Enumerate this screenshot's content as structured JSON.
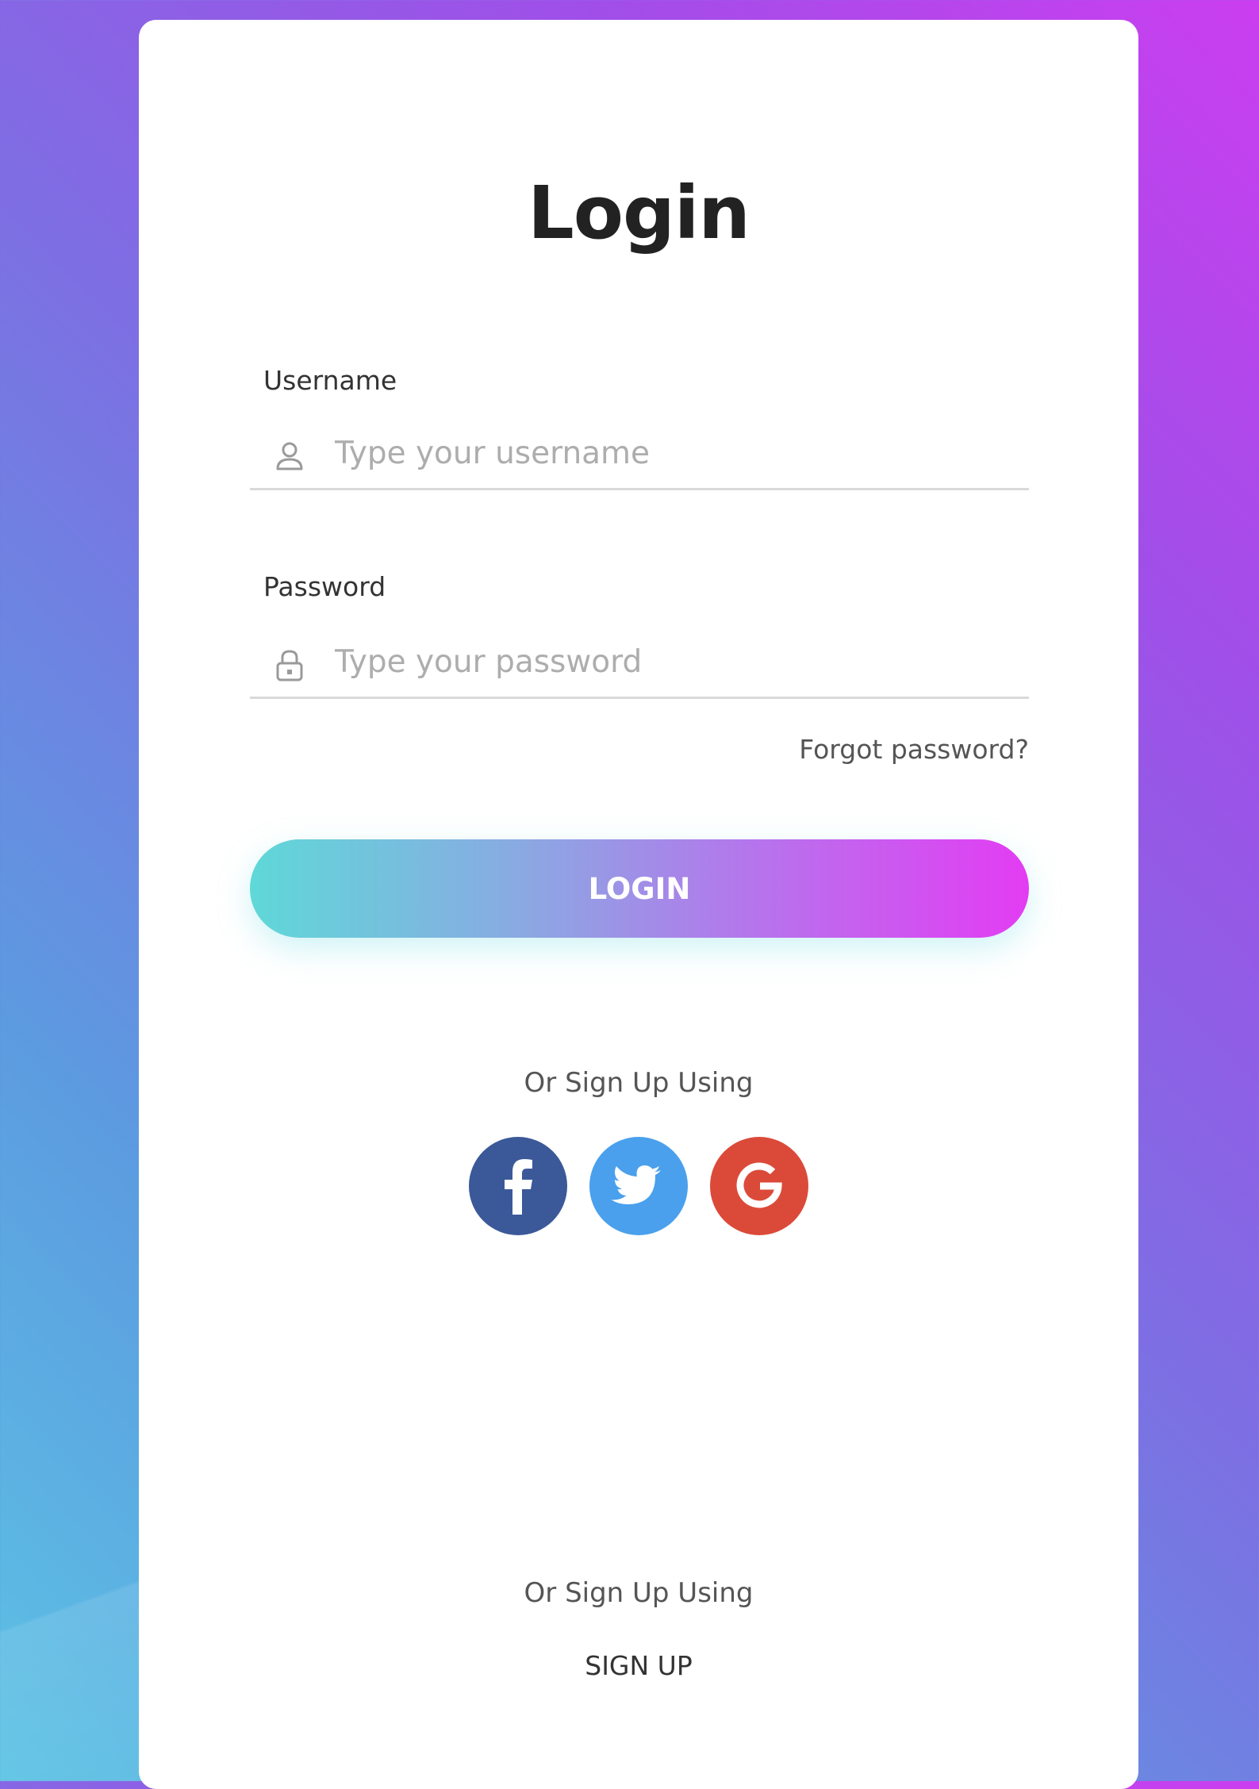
{
  "page": {
    "title": "Login"
  },
  "form": {
    "username": {
      "label": "Username",
      "placeholder": "Type your username",
      "icon": "user-icon"
    },
    "password": {
      "label": "Password",
      "placeholder": "Type your password",
      "icon": "lock-icon"
    },
    "forgot_label": "Forgot password?",
    "login_label": "LOGIN"
  },
  "social": {
    "heading": "Or Sign Up Using",
    "buttons": [
      {
        "name": "facebook",
        "icon": "facebook-icon",
        "color": "#3b5998"
      },
      {
        "name": "twitter",
        "icon": "twitter-icon",
        "color": "#4aa0ec"
      },
      {
        "name": "google",
        "icon": "google-icon",
        "color": "#db4a39"
      }
    ]
  },
  "footer": {
    "heading": "Or Sign Up Using",
    "signup_label": "SIGN UP"
  },
  "colors": {
    "gradient_start": "#5fd8d8",
    "gradient_end": "#e33cf3",
    "background_top_right": "#cb3ef0",
    "background_bottom_left": "#5cc3e4"
  }
}
